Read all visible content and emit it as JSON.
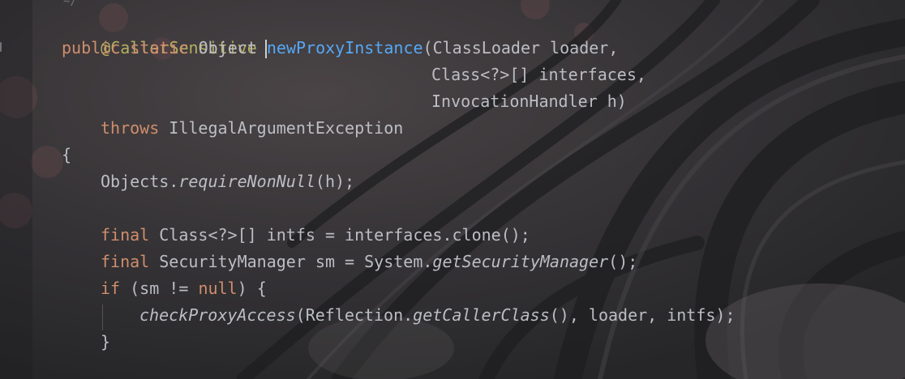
{
  "editor": {
    "top_icon": "~/",
    "lines": {
      "l1": {
        "ann": "@CallerSensitive"
      },
      "l2": {
        "kw1": "public",
        "kw2": "static",
        "type": "Object",
        "fn": "newProxyInstance",
        "rest": "(ClassLoader loader,"
      },
      "l3": {
        "text": "Class<?>[] interfaces,"
      },
      "l4": {
        "text": "InvocationHandler h)"
      },
      "l5": {
        "kw": "throws",
        "text": "IllegalArgumentException"
      },
      "l6": {
        "text": "{"
      },
      "l7": {
        "pre": "Objects.",
        "call": "requireNonNull",
        "post": "(h);"
      },
      "l9": {
        "kw": "final",
        "text": "Class<?>[] intfs = interfaces.clone();"
      },
      "l10": {
        "kw": "final",
        "pre": "SecurityManager sm = System.",
        "call": "getSecurityManager",
        "post": "();"
      },
      "l11": {
        "kw1": "if",
        "mid": "(sm != ",
        "kw2": "null",
        "post": ") {"
      },
      "l12": {
        "call1": "checkProxyAccess",
        "mid": "(Reflection.",
        "call2": "getCallerClass",
        "post": "(), loader, intfs);"
      },
      "l13": {
        "text": "}"
      }
    }
  },
  "colors": {
    "background": "#2a2a2c",
    "keyword": "#cf8e6d",
    "annotation": "#b3ae60",
    "method_declaration": "#56a8f5",
    "default_text": "#bcbec4"
  }
}
